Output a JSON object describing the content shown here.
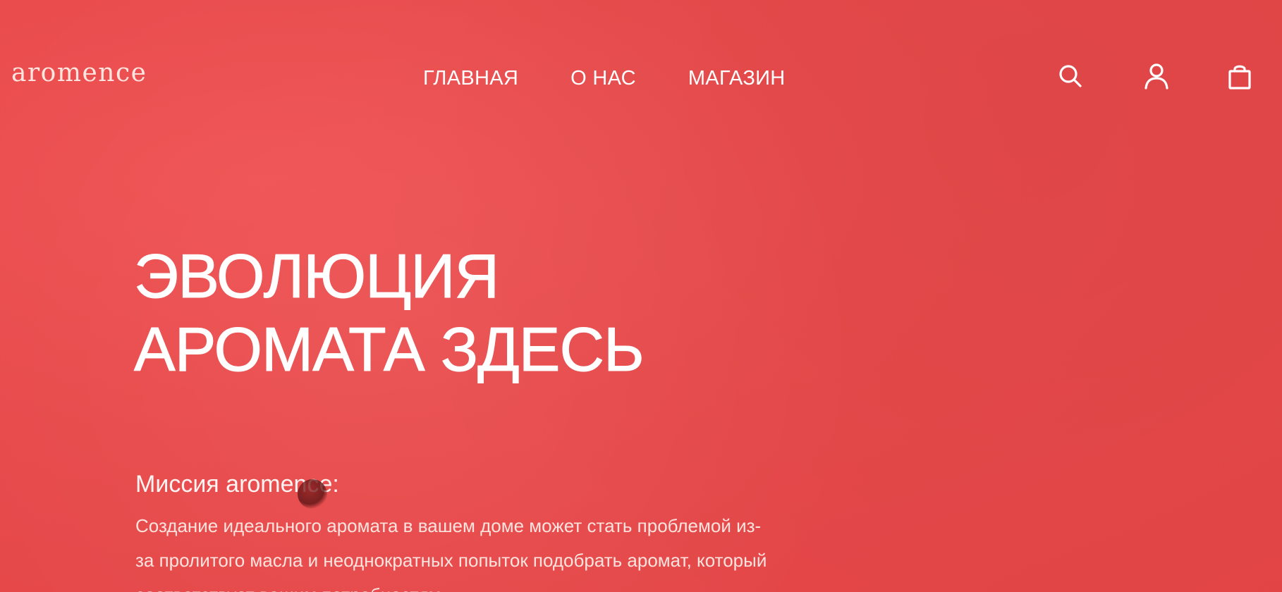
{
  "brand": {
    "logo": "aromence"
  },
  "nav": {
    "items": [
      "ГЛАВНАЯ",
      "О НАС",
      "МАГАЗИН"
    ]
  },
  "header_icons": [
    "search-icon",
    "account-icon",
    "shopping-bag-icon"
  ],
  "hero": {
    "title_line1": "ЭВОЛЮЦИЯ",
    "title_line2": "АРОМАТА ЗДЕСЬ"
  },
  "mission": {
    "title": "Миссия aromence:",
    "text": "Создание идеального аромата в вашем доме может стать проблемой из-за пролитого масла и неоднократных попыток подобрать аромат, который соответствует вашим потребностям"
  },
  "colors": {
    "background": "#e84a4b",
    "text": "#ffffff"
  }
}
